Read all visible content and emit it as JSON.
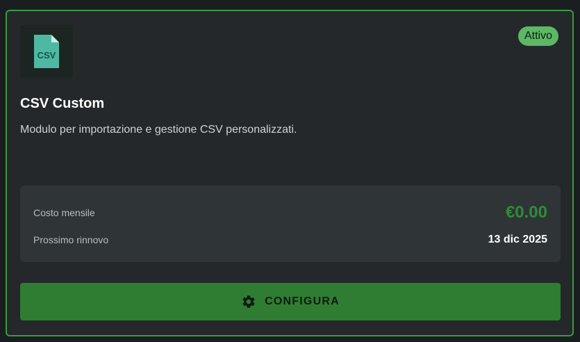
{
  "module": {
    "icon": "csv-file-icon",
    "icon_text": "CSV",
    "status_badge": "Attivo",
    "title": "CSV Custom",
    "description": "Modulo per importazione e gestione CSV personalizzati."
  },
  "billing": {
    "monthly_cost_label": "Costo mensile",
    "monthly_cost_value": "€0.00",
    "renewal_label": "Prossimo rinnovo",
    "renewal_value": "13 dic 2025"
  },
  "actions": {
    "configure_label": "CONFIGURA",
    "configure_icon": "gear-icon"
  },
  "colors": {
    "border_accent": "#3a9a3e",
    "badge_bg": "#5cb865",
    "price": "#2f8c37",
    "button_bg": "#2e7d32",
    "icon_teal": "#4fb8a3"
  }
}
